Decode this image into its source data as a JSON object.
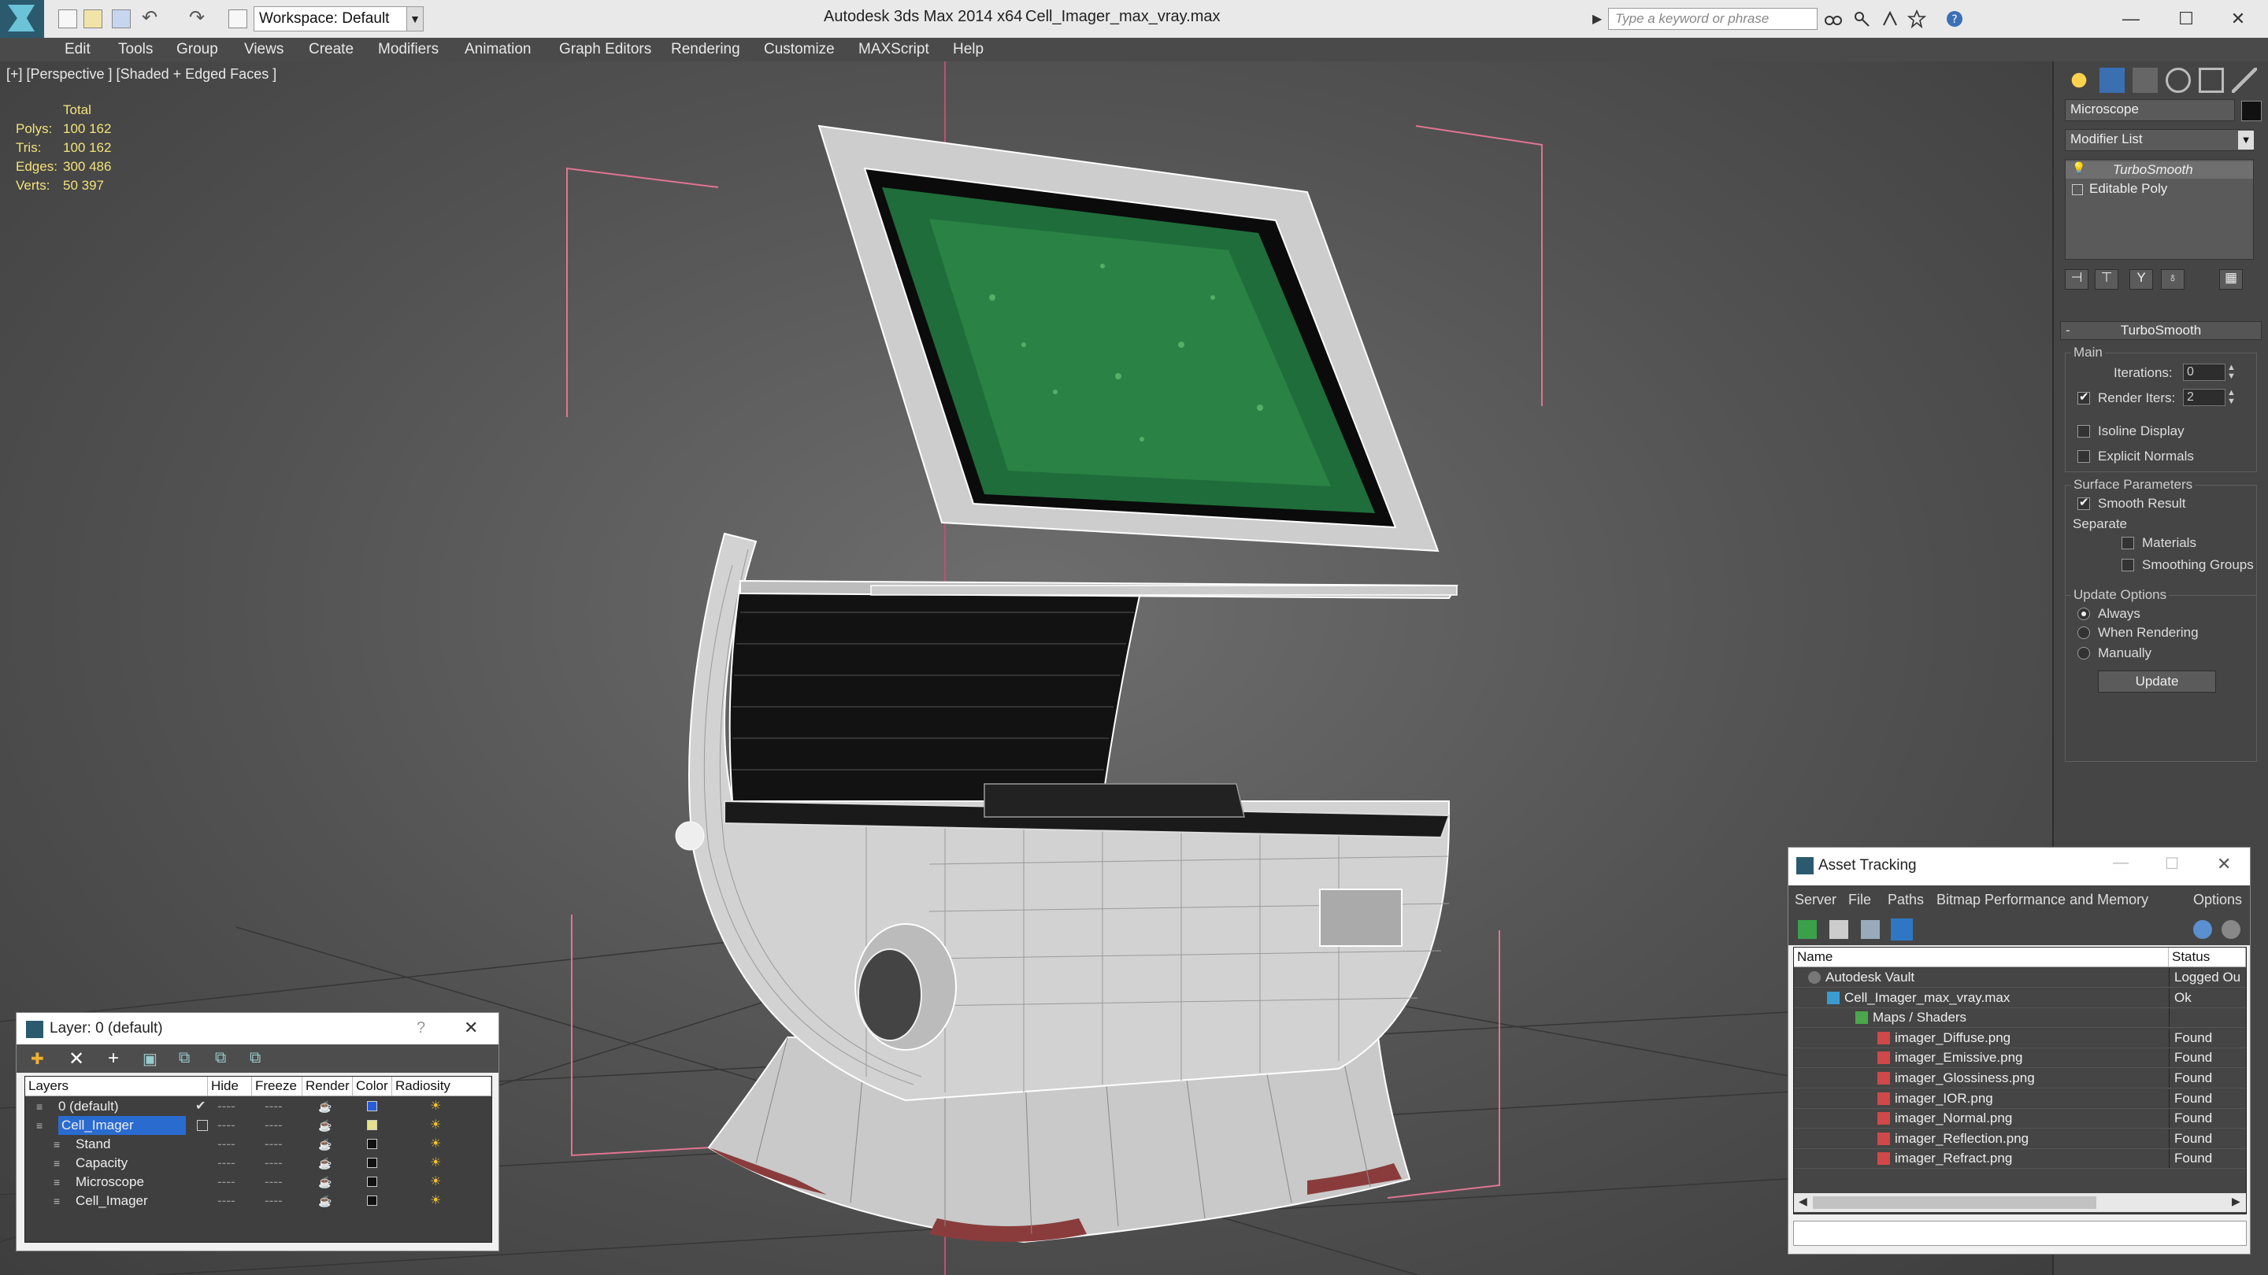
{
  "window": {
    "app_title": "Autodesk 3ds Max  2014 x64",
    "file_title": "Cell_Imager_max_vray.max",
    "workspace": "Workspace: Default",
    "search_placeholder": "Type a keyword or phrase",
    "minimize": "—",
    "maximize": "☐",
    "close": "✕"
  },
  "menu": [
    "Edit",
    "Tools",
    "Group",
    "Views",
    "Create",
    "Modifiers",
    "Animation",
    "Graph Editors",
    "Rendering",
    "Customize",
    "MAXScript",
    "Help"
  ],
  "viewport": {
    "label": "[+] [Perspective ] [Shaded + Edged Faces ]",
    "stats": {
      "header": "Total",
      "rows": [
        {
          "k": "Polys:",
          "v": "100 162"
        },
        {
          "k": "Tris:",
          "v": "100 162"
        },
        {
          "k": "Edges:",
          "v": "300 486"
        },
        {
          "k": "Verts:",
          "v": "50 397"
        }
      ]
    }
  },
  "command_panel": {
    "object_name": "Microscope",
    "modifier_list": "Modifier List",
    "stack": [
      "TurboSmooth",
      "Editable Poly"
    ],
    "rollout_title": "TurboSmooth",
    "main_label": "Main",
    "iterations_label": "Iterations:",
    "iterations_value": "0",
    "render_iters_label": "Render Iters:",
    "render_iters_value": "2",
    "isoline": "Isoline Display",
    "explicit_normals": "Explicit Normals",
    "surface_params": "Surface Parameters",
    "smooth_result": "Smooth Result",
    "separate": "Separate",
    "materials": "Materials",
    "smoothing_groups": "Smoothing Groups",
    "update_options": "Update Options",
    "always": "Always",
    "when_rendering": "When Rendering",
    "manually": "Manually",
    "update_button": "Update",
    "rollout_collapse": "-"
  },
  "layer_dialog": {
    "title": "Layer: 0 (default)",
    "help": "?",
    "close": "✕",
    "columns": [
      "Layers",
      "Hide",
      "Freeze",
      "Render",
      "Color",
      "Radiosity"
    ],
    "rows": [
      {
        "name": "0 (default)",
        "dash_hide": "----",
        "dash_freeze": "----",
        "color": "#2a5bd7"
      },
      {
        "name": "Cell_Imager",
        "dash_hide": "----",
        "dash_freeze": "----",
        "color": "#e6e08a"
      },
      {
        "name": "Stand",
        "dash_hide": "----",
        "dash_freeze": "----",
        "color": "#111111"
      },
      {
        "name": "Capacity",
        "dash_hide": "----",
        "dash_freeze": "----",
        "color": "#111111"
      },
      {
        "name": "Microscope",
        "dash_hide": "----",
        "dash_freeze": "----",
        "color": "#111111"
      },
      {
        "name": "Cell_Imager",
        "dash_hide": "----",
        "dash_freeze": "----",
        "color": "#111111"
      }
    ]
  },
  "asset_dialog": {
    "title": "Asset Tracking",
    "menu": [
      "Server",
      "File",
      "Paths",
      "Bitmap Performance and Memory",
      "Options"
    ],
    "col_name": "Name",
    "col_status": "Status",
    "rows": [
      {
        "name": "Autodesk Vault",
        "status": "Logged Ou"
      },
      {
        "name": "Cell_Imager_max_vray.max",
        "status": "Ok"
      },
      {
        "name": "Maps / Shaders",
        "status": ""
      },
      {
        "name": "imager_Diffuse.png",
        "status": "Found"
      },
      {
        "name": "imager_Emissive.png",
        "status": "Found"
      },
      {
        "name": "imager_Glossiness.png",
        "status": "Found"
      },
      {
        "name": "imager_IOR.png",
        "status": "Found"
      },
      {
        "name": "imager_Normal.png",
        "status": "Found"
      },
      {
        "name": "imager_Reflection.png",
        "status": "Found"
      },
      {
        "name": "imager_Refract.png",
        "status": "Found"
      }
    ],
    "minimize": "—",
    "maximize": "☐",
    "close": "✕"
  }
}
